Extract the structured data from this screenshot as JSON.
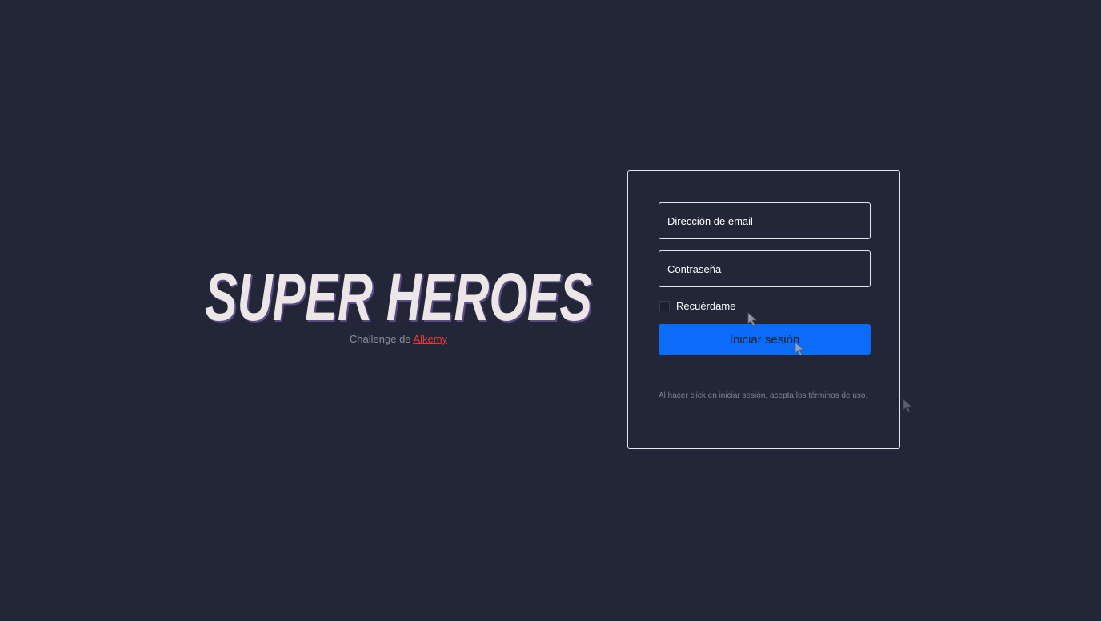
{
  "brand": {
    "logo_text": "SUPER HEROES",
    "subtitle_prefix": "Challenge de ",
    "subtitle_link": "Alkemy"
  },
  "login": {
    "email_placeholder": "Dirección de email",
    "password_placeholder": "Contraseña",
    "remember_label": "Recuérdame",
    "submit_label": "Iniciar sesión",
    "terms_text": "Al hacer click en iniciar sesión, acepta los términos de uso."
  },
  "colors": {
    "background": "#232636",
    "accent_button": "#0b6cf9",
    "link": "#e23a3a",
    "logo_fill": "#ece6e6",
    "logo_shadow": "#5a4a8a"
  }
}
